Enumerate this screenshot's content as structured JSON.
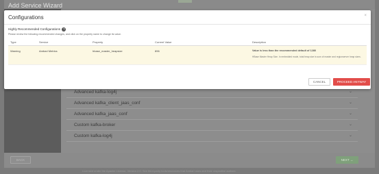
{
  "wizard": {
    "title": "Add Service Wizard",
    "back_label": "BACK",
    "next_label": "NEXT →",
    "accordion": [
      "Advanced kafka-log4j",
      "Advanced kafka_client_jaas_conf",
      "Advanced kafka_jaas_conf",
      "Custom kafka-broker",
      "Custom kafka-log4j"
    ],
    "footer_text": "Licensed under the Apache License, Version 2.0. See third-party tools/resources that Ambari uses and their respective authors"
  },
  "modal": {
    "title": "Configurations",
    "close_glyph": "×",
    "section_heading": "Highly Recommended Configurations",
    "help_glyph": "?",
    "instructions": "Please review the following recommended changes, and click on the property name to change its value.",
    "table": {
      "headers": [
        "Type",
        "Service",
        "Property",
        "Current Value",
        "Description"
      ],
      "rows": [
        {
          "type": "Warning",
          "service": "Ambari Metrics",
          "property": "hbase_master_heapsize",
          "current_value": "896",
          "description_main": "Value is less than the recommended default of 1280",
          "description_sub": "HBase Master Heap Size. In embedded mode, total heap size is sum of master and regionserver heap sizes."
        }
      ]
    },
    "cancel_label": "CANCEL",
    "proceed_label": "PROCEED ANYWAY"
  },
  "colors": {
    "proceed": "#e24d4a",
    "warning_row": "#fcf8e3",
    "next": "#7fa07b"
  }
}
